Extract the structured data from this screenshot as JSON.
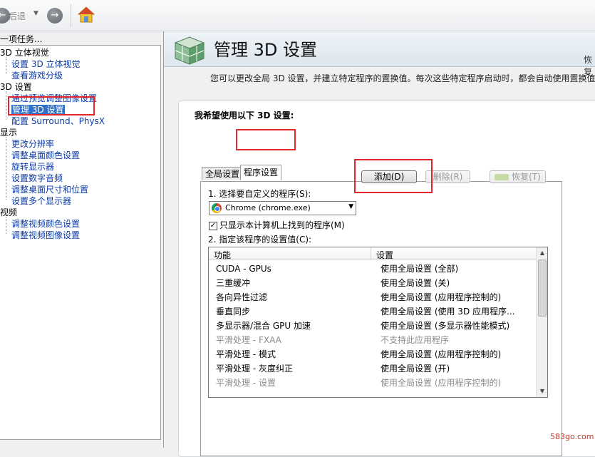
{
  "toolbar": {
    "back_label": "后退",
    "back_icon": "back-arrow-icon",
    "forward_icon": "forward-arrow-icon",
    "home_icon": "home-icon"
  },
  "sidebar": {
    "header": "一项任务...",
    "categories": [
      {
        "label": "3D 立体视觉",
        "items": [
          "设置 3D 立体视觉",
          "查看游戏分级"
        ]
      },
      {
        "label": "3D 设置",
        "items": [
          "通过预览调整图像设置",
          "管理 3D 设置",
          "配置 Surround、PhysX"
        ]
      },
      {
        "label": "显示",
        "items": [
          "更改分辨率",
          "调整桌面颜色设置",
          "旋转显示器",
          "设置数字音频",
          "调整桌面尺寸和位置",
          "设置多个显示器"
        ]
      },
      {
        "label": "视频",
        "items": [
          "调整视频颜色设置",
          "调整视频图像设置"
        ]
      }
    ],
    "selected_item": "管理 3D 设置"
  },
  "main": {
    "title": "管理 3D 设置",
    "restore_link": "恢复",
    "description": "您可以更改全局 3D 设置，并建立特定程序的置换值。每次这些特定程序启动时，都会自动使用置换值",
    "settings_heading": "我希望使用以下 3D 设置:",
    "tabs": [
      {
        "label": "全局设置",
        "active": false
      },
      {
        "label": "程序设置",
        "active": true
      }
    ],
    "step1_label": "1. 选择要自定义的程序(S):",
    "program_select": "Chrome (chrome.exe)",
    "buttons": {
      "add": "添加(D)",
      "remove": "删除(R)",
      "restore": "恢复(T)"
    },
    "checkbox_label": "只显示本计算机上找到的程序(M)",
    "checkbox_checked": true,
    "step2_label": "2. 指定该程序的设置值(C):",
    "columns": [
      "功能",
      "设置"
    ],
    "rows": [
      {
        "feature": "CUDA - GPUs",
        "setting": "使用全局设置 (全部)",
        "disabled": false
      },
      {
        "feature": "三重缓冲",
        "setting": "使用全局设置 (关)",
        "disabled": false
      },
      {
        "feature": "各向异性过滤",
        "setting": "使用全局设置 (应用程序控制的)",
        "disabled": false
      },
      {
        "feature": "垂直同步",
        "setting": "使用全局设置 (使用 3D 应用程序...",
        "disabled": false
      },
      {
        "feature": "多显示器/混合 GPU 加速",
        "setting": "使用全局设置 (多显示器性能模式)",
        "disabled": false
      },
      {
        "feature": "平滑处理 - FXAA",
        "setting": "不支持此应用程序",
        "disabled": true
      },
      {
        "feature": "平滑处理 - 模式",
        "setting": "使用全局设置 (应用程序控制的)",
        "disabled": false
      },
      {
        "feature": "平滑处理 - 灰度纠正",
        "setting": "使用全局设置 (开)",
        "disabled": false
      },
      {
        "feature": "平滑处理 - 设置",
        "setting": "使用全局设置 (应用程序控制的)",
        "disabled": true
      }
    ]
  },
  "watermark": "583go.com",
  "colors": {
    "highlight_red": "#e3262b",
    "selection_blue": "#3070c8",
    "link_blue": "#0a3aa8"
  }
}
